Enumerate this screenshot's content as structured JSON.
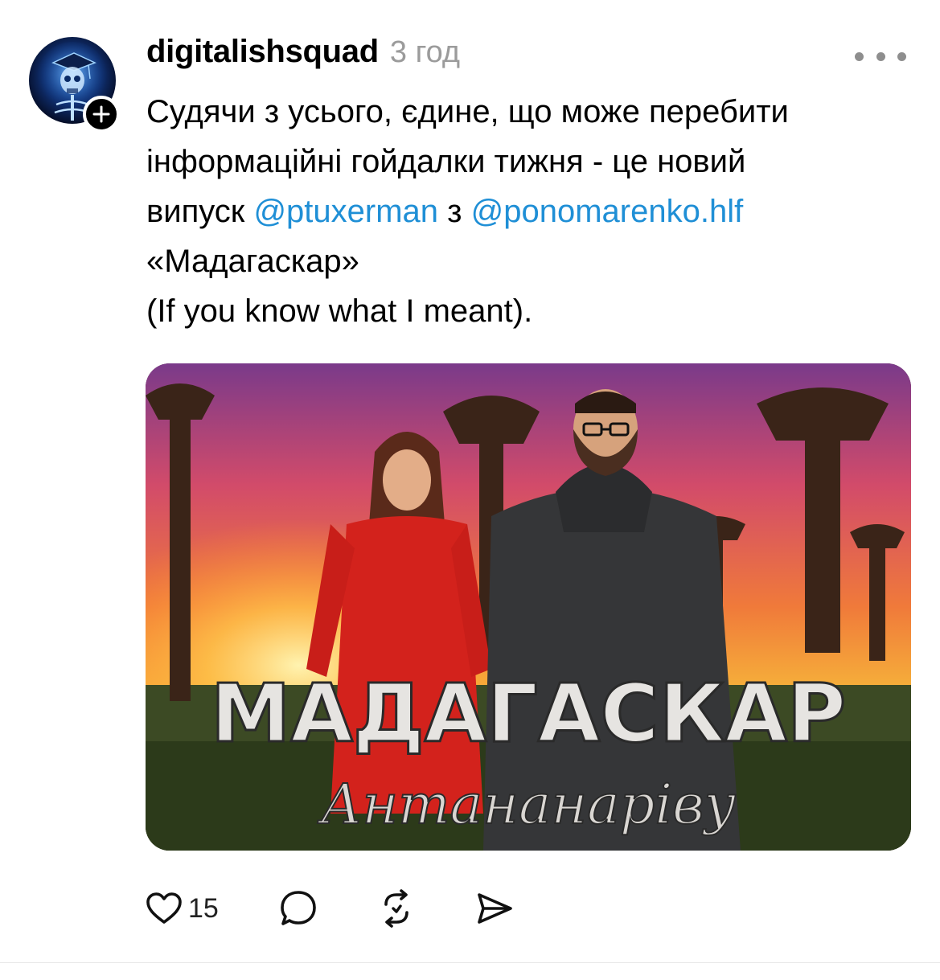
{
  "post": {
    "username": "digitalishsquad",
    "time": "3 год",
    "text_lines": [
      "Судячи з усього, єдине, що може перебити",
      "інформаційні гойдалки тижня - це новий",
      "випуск",
      "з",
      "«Мадагаскар»",
      "(If you know what I meant)."
    ],
    "mentions": [
      "@ptuxerman",
      "@ponomarenko.hlf"
    ],
    "image": {
      "title": "МАДАГАСКАР",
      "subtitle": "Антананаріву"
    }
  },
  "actions": {
    "like_count": "15"
  },
  "icons": {
    "more": "more-icon",
    "like": "heart-icon",
    "comment": "comment-icon",
    "repost": "repost-icon",
    "share": "share-icon",
    "follow": "plus-icon"
  },
  "colors": {
    "mention": "#1f8fd6",
    "time": "#9b9b9b",
    "icon": "#000000"
  }
}
